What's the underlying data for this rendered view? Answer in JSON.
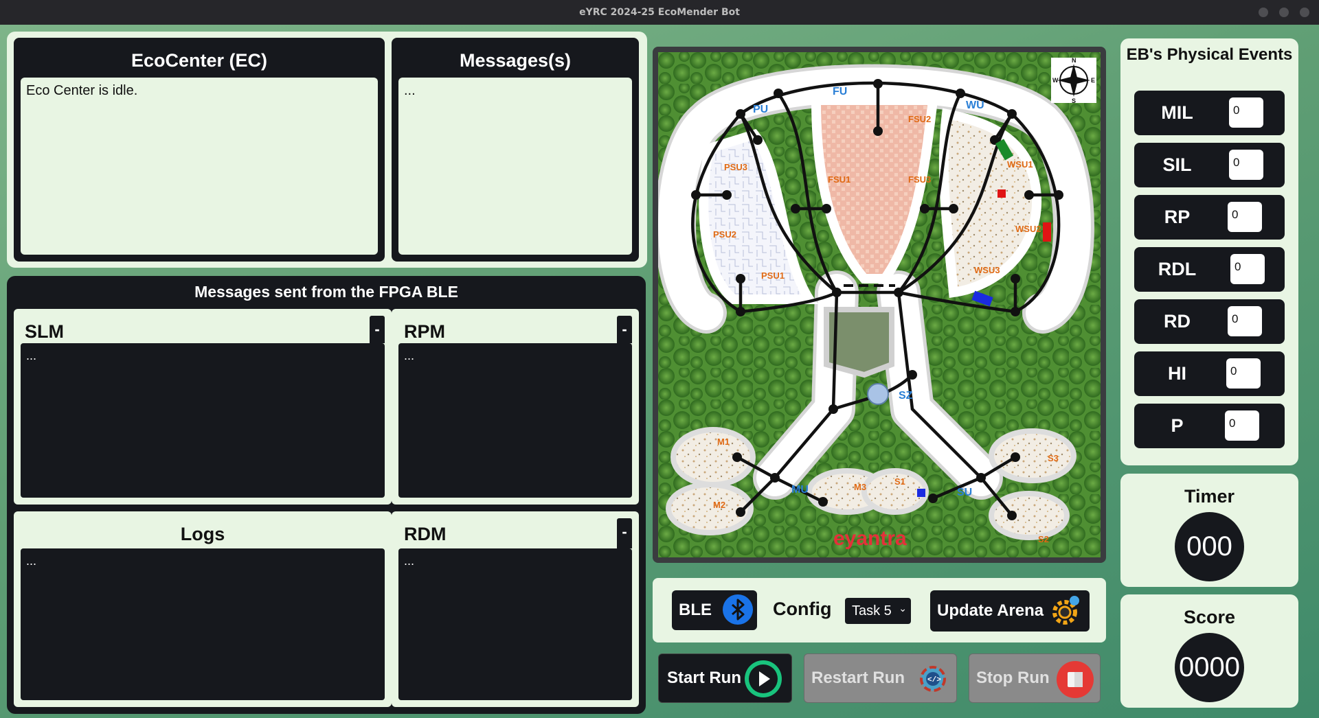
{
  "window": {
    "title": "eYRC 2024-25 EcoMender Bot"
  },
  "eco_center": {
    "title": "EcoCenter (EC)",
    "text": "Eco Center is idle."
  },
  "messages": {
    "title": "Messages(s)",
    "text": "..."
  },
  "fpga": {
    "title": "Messages sent from the FPGA BLE",
    "slm": {
      "title": "SLM",
      "collapse": "-",
      "text": "..."
    },
    "rpm": {
      "title": "RPM",
      "collapse": "-",
      "text": "..."
    },
    "logs": {
      "title": "Logs",
      "text": "..."
    },
    "rdm": {
      "title": "RDM",
      "collapse": "-",
      "text": "..."
    }
  },
  "arena": {
    "labels": {
      "pu": "PU",
      "fu": "FU",
      "wu": "WU",
      "psu3": "PSU3",
      "psu2": "PSU2",
      "psu1": "PSU1",
      "fsu1": "FSU1",
      "fsu2": "FSU2",
      "fsu3": "FSU3",
      "wsu1": "WSU1",
      "wsu2": "WSU2",
      "wsu3": "WSU3",
      "sz": "SZ",
      "m1": "M1",
      "m2": "M2",
      "m3": "M3",
      "mu": "MU",
      "s1": "S1",
      "s2": "S2",
      "s3": "S3",
      "su": "SU"
    },
    "compass": {
      "n": "N",
      "s": "S",
      "e": "E",
      "w": "W"
    },
    "logo": "eyantra"
  },
  "controls": {
    "ble_label": "BLE",
    "config_label": "Config",
    "config_selected": "Task 5",
    "update_label": "Update Arena",
    "start_label": "Start Run",
    "restart_label": "Restart Run",
    "stop_label": "Stop Run"
  },
  "events": {
    "title": "EB's Physical Events",
    "items": [
      {
        "label": "MIL",
        "value": "0"
      },
      {
        "label": "SIL",
        "value": "0"
      },
      {
        "label": "RP",
        "value": "0"
      },
      {
        "label": "RDL",
        "value": "0"
      },
      {
        "label": "RD",
        "value": "0"
      },
      {
        "label": "HI",
        "value": "0"
      },
      {
        "label": "P",
        "value": "0"
      }
    ]
  },
  "timer": {
    "title": "Timer",
    "value": "000"
  },
  "score": {
    "title": "Score",
    "value": "0000"
  },
  "colors": {
    "accent_dark": "#16181d",
    "panel_light": "#e8f5e3",
    "ble_blue": "#1a73e8",
    "start_green": "#19c37d",
    "stop_red": "#e53935"
  }
}
